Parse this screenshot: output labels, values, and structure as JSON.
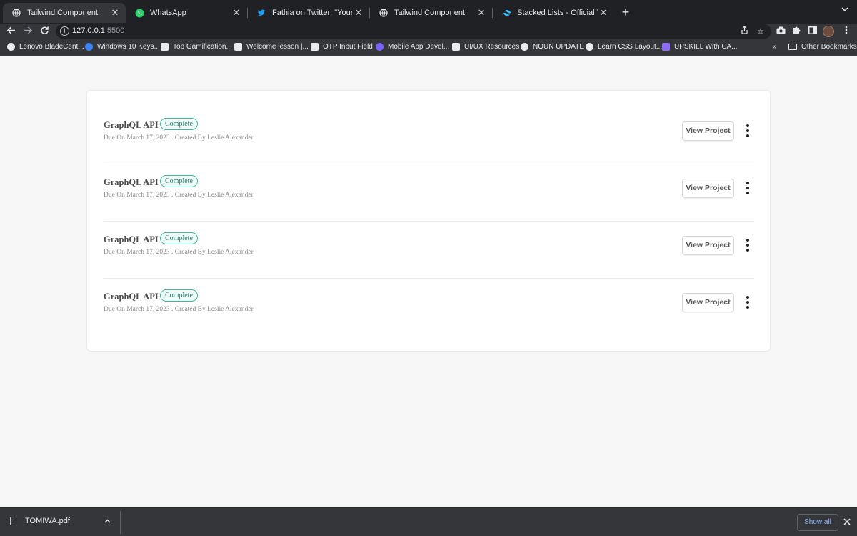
{
  "browser": {
    "tabs": [
      {
        "title": "Tailwind Component",
        "icon": "globe-icon",
        "active": true
      },
      {
        "title": "WhatsApp",
        "icon": "whatsapp-icon",
        "active": false
      },
      {
        "title": "Fathia on Twitter: \"Your Growth",
        "icon": "twitter-icon",
        "active": false
      },
      {
        "title": "Tailwind Component",
        "icon": "globe-icon",
        "active": false
      },
      {
        "title": "Stacked Lists - Official Tailwind",
        "icon": "tailwind-icon",
        "active": false
      }
    ],
    "close_glyph": "✕",
    "new_tab_glyph": "+",
    "url_host": "127.0.0.1",
    "url_port": ":5500",
    "bookmarks": [
      {
        "label": "Lenovo BladeCent...",
        "icon": "globe-icon"
      },
      {
        "label": "Windows 10 Keys...",
        "icon": "key-icon"
      },
      {
        "label": "Top Gamification...",
        "icon": "link-icon"
      },
      {
        "label": "Welcome lesson |...",
        "icon": "cube-icon"
      },
      {
        "label": "OTP Input Field",
        "icon": "codepen-icon"
      },
      {
        "label": "Mobile App Devel...",
        "icon": "app-icon"
      },
      {
        "label": "UI/UX Resources",
        "icon": "notion-icon"
      },
      {
        "label": "NOUN UPDATE",
        "icon": "globe-icon"
      },
      {
        "label": "Learn CSS Layout...",
        "icon": "globe-icon"
      },
      {
        "label": "UPSKILL With CA...",
        "icon": "list-icon"
      }
    ],
    "bookmarks_overflow": "»",
    "other_bookmarks": "Other Bookmarks"
  },
  "list": {
    "items": [
      {
        "title": "GraphQL API",
        "status": "Complete",
        "meta": "Due On March 17, 2023 . Created By Leslie Alexander",
        "action": "View Project"
      },
      {
        "title": "GraphQL API",
        "status": "Complete",
        "meta": "Due On March 17, 2023 . Created By Leslie Alexander",
        "action": "View Project"
      },
      {
        "title": "GraphQL API",
        "status": "Complete",
        "meta": "Due On March 17, 2023 . Created By Leslie Alexander",
        "action": "View Project"
      },
      {
        "title": "GraphQL API",
        "status": "Complete",
        "meta": "Due On March 17, 2023 . Created By Leslie Alexander",
        "action": "View Project"
      }
    ]
  },
  "downloads": {
    "file": "TOMIWA.pdf",
    "show_all": "Show all"
  },
  "colors": {
    "badge_border": "#3fb7a2",
    "badge_text": "#1f7a69",
    "chrome_dark": "#202124",
    "chrome": "#35363a"
  }
}
